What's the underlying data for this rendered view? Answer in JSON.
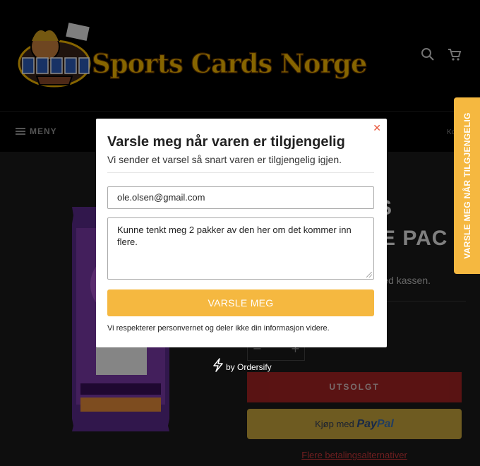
{
  "header": {
    "logo_text": "Sports Cards Norge",
    "search_icon": "search-icon",
    "cart_icon": "cart-icon"
  },
  "nav": {
    "menu_label": "MENY",
    "right_text": "Ko"
  },
  "product": {
    "title_line1": "ONS",
    "title_line2": "LUE PAC",
    "tax_note": "ed kassen.",
    "qty_minus": "−",
    "qty_plus": "+",
    "soldout_label": "UTSOLGT",
    "paypal_prefix": "Kjøp med",
    "paypal_brand_a": "Pay",
    "paypal_brand_b": "Pal",
    "more_payment_label": "Flere betalingsalternativer"
  },
  "side_tab": {
    "label": "VARSLE MEG NÅR TILGJENGELIG",
    "color": "#f5b840"
  },
  "modal": {
    "title": "Varsle meg når varen er tilgjengelig",
    "subtitle": "Vi sender et varsel så snart varen er tilgjengelig igjen.",
    "email_value": "ole.olsen@gmail.com",
    "message_value": "Kunne tenkt meg 2 pakker av den her om det kommer inn flere.",
    "submit_label": "VARSLE MEG",
    "privacy_text": "Vi respekterer personvernet og deler ikke din informasjon videre.",
    "close_icon": "close-icon",
    "accent": "#f5b840"
  },
  "powered_by": {
    "text": "by Ordersify"
  }
}
